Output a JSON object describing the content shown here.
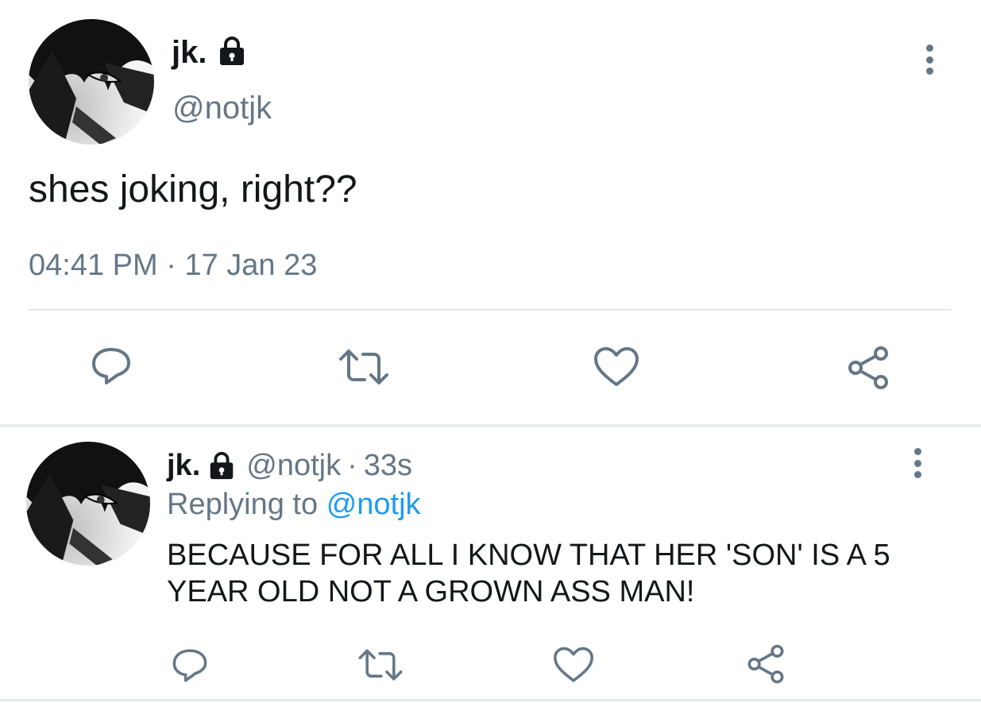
{
  "main_tweet": {
    "display_name": "jk.",
    "handle": "@notjk",
    "text": "shes joking, right??",
    "time": "04:41 PM",
    "separator": "·",
    "date": "17 Jan 23",
    "actions": [
      "reply-icon",
      "retweet-icon",
      "like-icon",
      "share-icon"
    ]
  },
  "reply_tweet": {
    "display_name": "jk.",
    "handle": "@notjk",
    "separator": "·",
    "age": "33s",
    "replying_prefix": "Replying to",
    "replying_handle": "@notjk",
    "text": "BECAUSE FOR ALL I KNOW THAT HER 'SON' IS A 5 YEAR OLD NOT A GROWN ASS MAN!",
    "actions": [
      "reply-icon",
      "retweet-icon",
      "like-icon",
      "share-icon"
    ]
  },
  "colors": {
    "text": "#14171a",
    "secondary": "#657786",
    "link": "#1d9bf0",
    "divider": "#e1e8ed"
  }
}
